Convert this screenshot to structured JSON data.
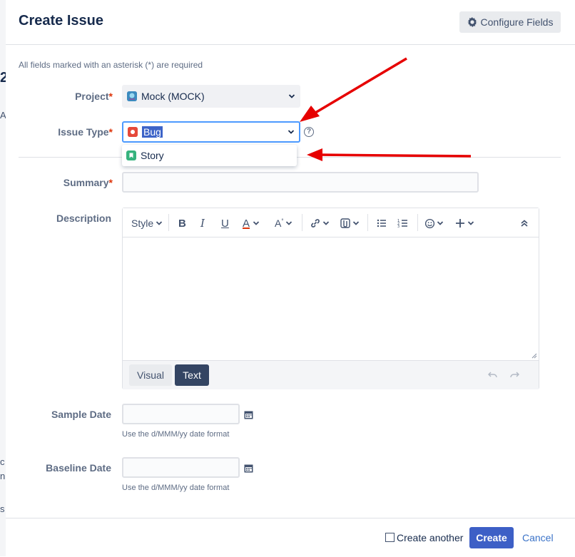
{
  "dialog": {
    "title": "Create Issue",
    "configure_fields_label": "Configure Fields",
    "required_note": "All fields marked with an asterisk (*) are required"
  },
  "fields": {
    "project": {
      "label": "Project",
      "value": "Mock (MOCK)"
    },
    "issue_type": {
      "label": "Issue Type",
      "value": "Bug",
      "options": [
        "Story"
      ]
    },
    "summary": {
      "label": "Summary",
      "value": ""
    },
    "description": {
      "label": "Description",
      "toolbar": {
        "style_label": "Style"
      },
      "tabs": [
        "Visual",
        "Text"
      ],
      "active_tab": "Text"
    },
    "sample_date": {
      "label": "Sample Date",
      "hint": "Use the d/MMM/yy date format"
    },
    "baseline_date": {
      "label": "Baseline Date",
      "hint": "Use the d/MMM/yy date format"
    }
  },
  "required_marker": "*",
  "footer": {
    "create_another_label": "Create another",
    "create_another_checked": false,
    "create_label": "Create",
    "cancel_label": "Cancel"
  },
  "background_fragments": [
    "2",
    "A",
    "c",
    "n",
    "s"
  ],
  "colors": {
    "primary": "#3d5fc6",
    "required": "#de350b",
    "annotation_arrow": "#e60000",
    "bug_icon": "#e5493a",
    "story_icon": "#36b37e"
  }
}
